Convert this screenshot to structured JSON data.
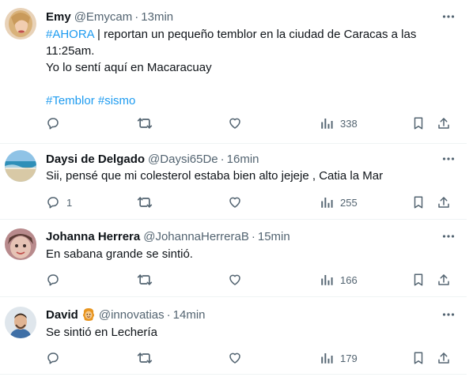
{
  "tweets": [
    {
      "name": "Emy",
      "handle": "@Emycam",
      "time": "13min",
      "hashtag_lead": "#AHORA",
      "text_line1_rest": " | reportan un pequeño temblor en la ciudad de Caracas a las",
      "text_line2": "11:25am.",
      "text_line3": "Yo lo sentí aquí en Macaracuay",
      "hashtag1": "#Temblor",
      "hashtag2": "#sismo",
      "replies": "",
      "retweets": "",
      "likes": "",
      "views": "338",
      "icons": [
        "reply-icon",
        "retweet-icon",
        "like-icon",
        "views-icon",
        "bookmark-icon",
        "share-icon"
      ]
    },
    {
      "name": "Daysi de Delgado",
      "handle": "@Daysi65De",
      "time": "16min",
      "text": "Sii, pensé que mi colesterol estaba bien alto jejeje , Catia la Mar",
      "replies": "1",
      "retweets": "",
      "likes": "",
      "views": "255"
    },
    {
      "name": "Johanna Herrera",
      "handle": "@JohannaHerreraB",
      "time": "15min",
      "text": "En sabana grande se sintió.",
      "replies": "",
      "retweets": "",
      "likes": "",
      "views": "166"
    },
    {
      "name": "David",
      "handle": "@innovatias",
      "time": "14min",
      "text": "Se sintió en Lechería",
      "replies": "",
      "retweets": "",
      "likes": "",
      "views": "179"
    }
  ],
  "separator": "·",
  "colors": {
    "text": "#0f1419",
    "secondary": "#536471",
    "link": "#1d9bf0",
    "divider": "#eff3f4"
  }
}
